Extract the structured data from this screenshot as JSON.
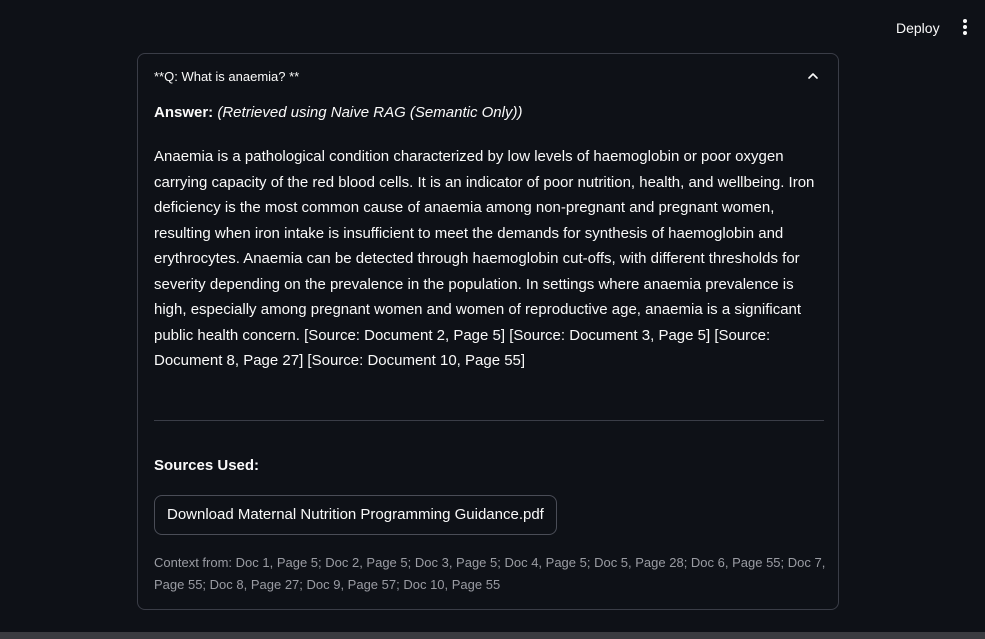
{
  "header": {
    "deploy_label": "Deploy",
    "menu_icon": "vertical-ellipsis-icon"
  },
  "expander": {
    "title": "**Q: What is anaemia? **",
    "state": "expanded",
    "chevron_icon": "chevron-up-icon",
    "answer_label": "Answer:",
    "answer_method": "(Retrieved using Naive RAG (Semantic Only))",
    "answer_text": "Anaemia is a pathological condition characterized by low levels of haemoglobin or poor oxygen carrying capacity of the red blood cells. It is an indicator of poor nutrition, health, and wellbeing. Iron deficiency is the most common cause of anaemia among non-pregnant and pregnant women, resulting when iron intake is insufficient to meet the demands for synthesis of haemoglobin and erythrocytes. Anaemia can be detected through haemoglobin cut-offs, with different thresholds for severity depending on the prevalence in the population. In settings where anaemia prevalence is high, especially among pregnant women and women of reproductive age, anaemia is a significant public health concern. [Source: Document 2, Page 5] [Source: Document 3, Page 5] [Source: Document 8, Page 27] [Source: Document 10, Page 55]",
    "sources_label": "Sources Used:",
    "download_label": "Download Maternal Nutrition Programming Guidance.pdf",
    "context_text": "Context from: Doc 1, Page 5; Doc 2, Page 5; Doc 3, Page 5; Doc 4, Page 5; Doc 5, Page 28; Doc 6, Page 55; Doc 7, Page 55; Doc 8, Page 27; Doc 9, Page 57; Doc 10, Page 55"
  },
  "colors": {
    "background": "#0e1117",
    "text": "#fafafa",
    "muted_text": "#9a9ca3",
    "border": "#3a3d47"
  }
}
